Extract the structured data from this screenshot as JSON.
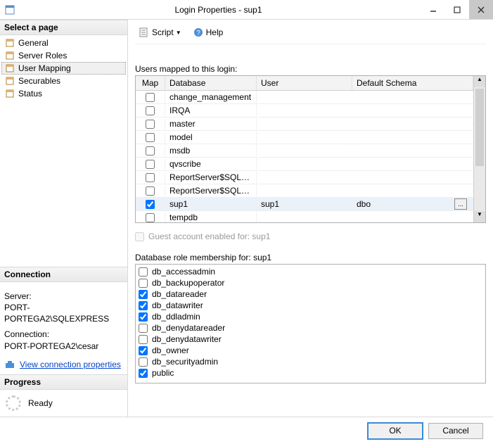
{
  "window": {
    "title": "Login Properties - sup1"
  },
  "left": {
    "select_page_header": "Select a page",
    "pages": [
      {
        "label": "General"
      },
      {
        "label": "Server Roles"
      },
      {
        "label": "User Mapping"
      },
      {
        "label": "Securables"
      },
      {
        "label": "Status"
      }
    ],
    "connection_header": "Connection",
    "server_label": "Server:",
    "server_value": "PORT-PORTEGA2\\SQLEXPRESS",
    "connection_label": "Connection:",
    "connection_value": "PORT-PORTEGA2\\cesar",
    "view_conn_link": "View connection properties",
    "progress_header": "Progress",
    "progress_status": "Ready"
  },
  "toolbar": {
    "script_label": "Script",
    "help_label": "Help"
  },
  "mapping": {
    "label": "Users mapped to this login:",
    "columns": {
      "map": "Map",
      "database": "Database",
      "user": "User",
      "schema": "Default Schema"
    },
    "rows": [
      {
        "checked": false,
        "database": "change_management",
        "user": "",
        "schema": ""
      },
      {
        "checked": false,
        "database": "IRQA",
        "user": "",
        "schema": ""
      },
      {
        "checked": false,
        "database": "master",
        "user": "",
        "schema": ""
      },
      {
        "checked": false,
        "database": "model",
        "user": "",
        "schema": ""
      },
      {
        "checked": false,
        "database": "msdb",
        "user": "",
        "schema": ""
      },
      {
        "checked": false,
        "database": "qvscribe",
        "user": "",
        "schema": ""
      },
      {
        "checked": false,
        "database": "ReportServer$SQLEX...",
        "user": "",
        "schema": ""
      },
      {
        "checked": false,
        "database": "ReportServer$SQLEX...",
        "user": "",
        "schema": ""
      },
      {
        "checked": true,
        "database": "sup1",
        "user": "sup1",
        "schema": "dbo",
        "selected": true
      },
      {
        "checked": false,
        "database": "tempdb",
        "user": "",
        "schema": ""
      }
    ],
    "browse": "...",
    "guest_label": "Guest account enabled for: sup1"
  },
  "roles": {
    "label": "Database role membership for: sup1",
    "items": [
      {
        "checked": false,
        "name": "db_accessadmin"
      },
      {
        "checked": false,
        "name": "db_backupoperator"
      },
      {
        "checked": true,
        "name": "db_datareader"
      },
      {
        "checked": true,
        "name": "db_datawriter"
      },
      {
        "checked": true,
        "name": "db_ddladmin"
      },
      {
        "checked": false,
        "name": "db_denydatareader"
      },
      {
        "checked": false,
        "name": "db_denydatawriter"
      },
      {
        "checked": true,
        "name": "db_owner"
      },
      {
        "checked": false,
        "name": "db_securityadmin"
      },
      {
        "checked": true,
        "name": "public"
      }
    ]
  },
  "footer": {
    "ok": "OK",
    "cancel": "Cancel"
  }
}
